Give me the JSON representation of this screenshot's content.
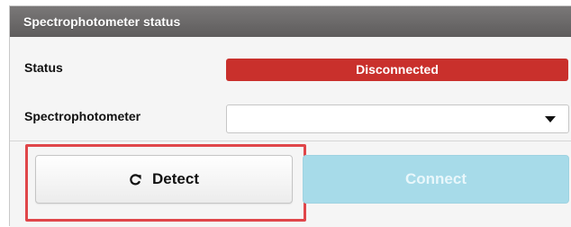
{
  "panel": {
    "title": "Spectrophotometer status"
  },
  "status": {
    "label": "Status",
    "value": "Disconnected",
    "color": "#c9302c"
  },
  "spectrophotometer": {
    "label": "Spectrophotometer",
    "selected_value": "",
    "dropdown_icon": "caret-down-icon"
  },
  "actions": {
    "detect_label": "Detect",
    "detect_icon": "refresh-icon",
    "connect_label": "Connect",
    "connect_enabled": false,
    "highlight_color": "#e0464a"
  }
}
